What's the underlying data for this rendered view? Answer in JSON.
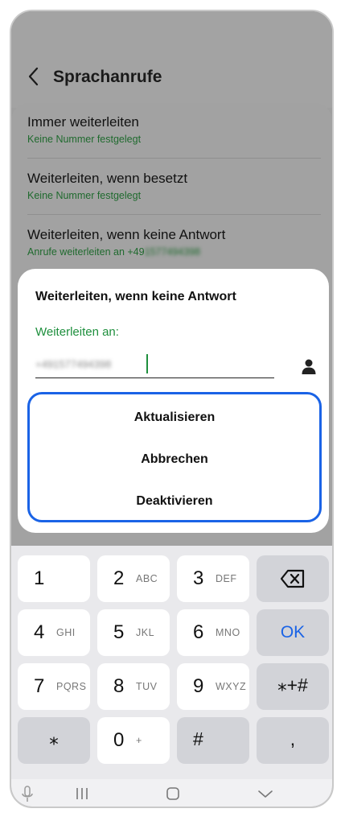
{
  "app": {
    "title": "Sprachanrufe",
    "settings": [
      {
        "title": "Immer weiterleiten",
        "subtitle": "Keine Nummer festgelegt"
      },
      {
        "title": "Weiterleiten, wenn besetzt",
        "subtitle": "Keine Nummer festgelegt"
      },
      {
        "title": "Weiterleiten, wenn keine Antwort",
        "subtitle": "Anrufe weiterleiten an +49",
        "subtitle_blurred": "1577494398"
      }
    ]
  },
  "dialog": {
    "title": "Weiterleiten, wenn keine Antwort",
    "label": "Weiterleiten an:",
    "input_value": "+491577494398",
    "options": [
      "Aktualisieren",
      "Abbrechen",
      "Deaktivieren"
    ],
    "accent_color": "#1e8f3d",
    "highlight_color": "#1a63e6"
  },
  "keyboard": {
    "rows": [
      [
        {
          "d": "1",
          "l": ""
        },
        {
          "d": "2",
          "l": "ABC"
        },
        {
          "d": "3",
          "l": "DEF"
        },
        {
          "icon": "backspace-icon"
        }
      ],
      [
        {
          "d": "4",
          "l": "GHI"
        },
        {
          "d": "5",
          "l": "JKL"
        },
        {
          "d": "6",
          "l": "MNO"
        },
        {
          "text": "OK"
        }
      ],
      [
        {
          "d": "7",
          "l": "PQRS"
        },
        {
          "d": "8",
          "l": "TUV"
        },
        {
          "d": "9",
          "l": "WXYZ"
        },
        {
          "text": "⁎+#"
        }
      ],
      [
        {
          "text": "⁎"
        },
        {
          "d": "0",
          "l": "+"
        },
        {
          "text": "#"
        },
        {
          "text": ","
        }
      ]
    ]
  },
  "navbar": {
    "icons": [
      "microphone-icon",
      "recent-apps-icon",
      "home-icon",
      "hide-keyboard-icon"
    ]
  }
}
